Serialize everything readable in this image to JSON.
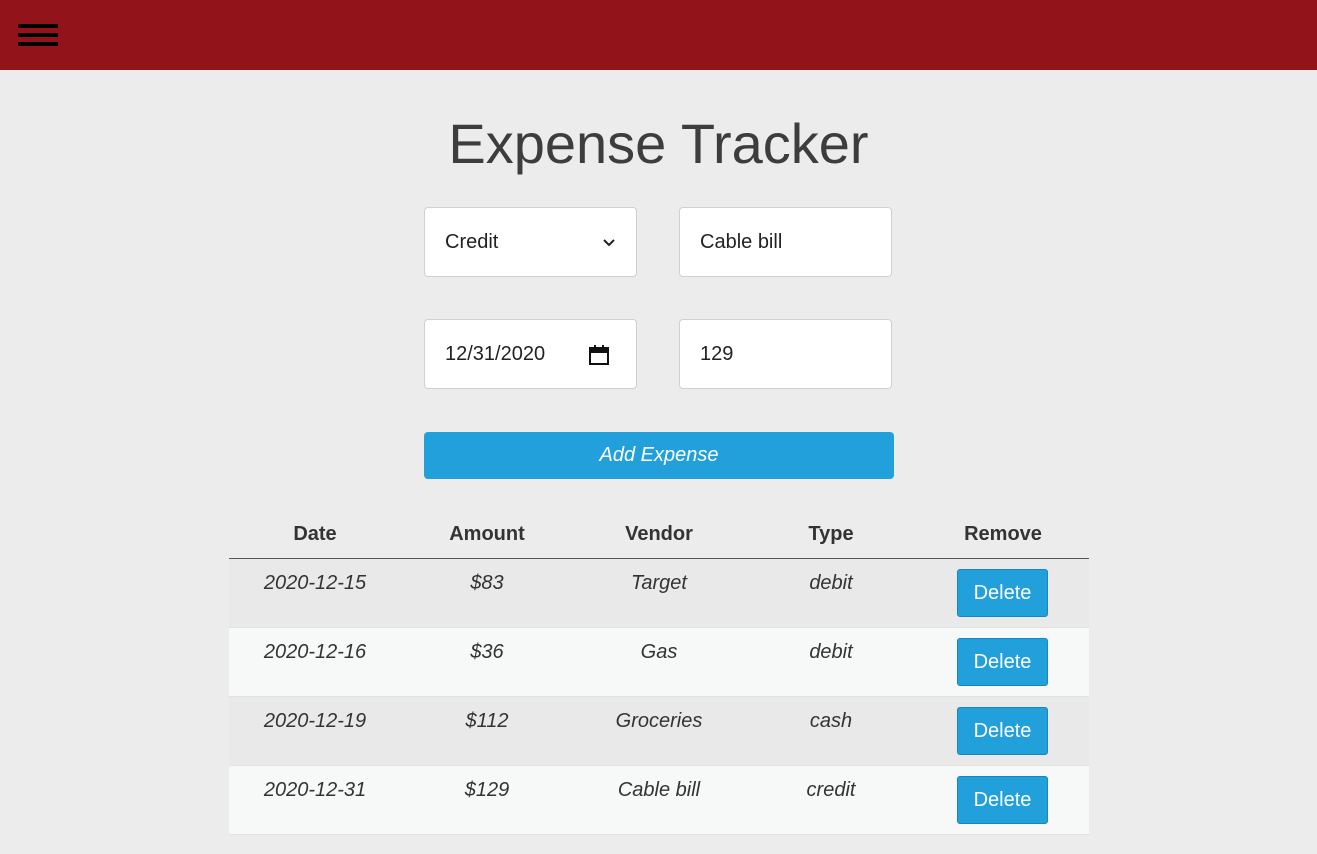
{
  "header": {
    "menu_icon": "hamburger-menu-icon",
    "color": "#93131b"
  },
  "page": {
    "title": "Expense Tracker"
  },
  "form": {
    "type_select": {
      "value": "Credit",
      "icon": "chevron-down-icon"
    },
    "vendor_input": {
      "value": "Cable bill"
    },
    "date_input": {
      "value": "12/31/2020",
      "icon": "calendar-icon"
    },
    "amount_input": {
      "value": "129"
    },
    "add_button_label": "Add Expense",
    "accent": "#22a0dc"
  },
  "table": {
    "columns": [
      "Date",
      "Amount",
      "Vendor",
      "Type",
      "Remove"
    ],
    "rows": [
      {
        "date": "2020-12-15",
        "amount": "$83",
        "vendor": "Target",
        "type": "debit",
        "remove_label": "Delete"
      },
      {
        "date": "2020-12-16",
        "amount": "$36",
        "vendor": "Gas",
        "type": "debit",
        "remove_label": "Delete"
      },
      {
        "date": "2020-12-19",
        "amount": "$112",
        "vendor": "Groceries",
        "type": "cash",
        "remove_label": "Delete"
      },
      {
        "date": "2020-12-31",
        "amount": "$129",
        "vendor": "Cable bill",
        "type": "credit",
        "remove_label": "Delete"
      }
    ]
  }
}
